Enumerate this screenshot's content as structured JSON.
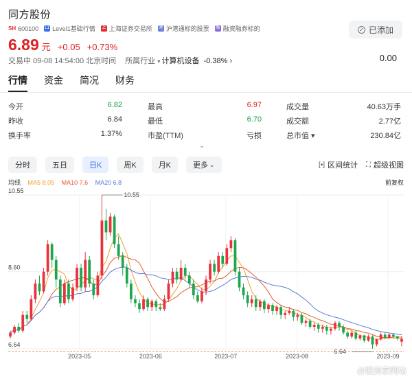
{
  "stock": {
    "name": "同方股份",
    "market": "SH",
    "code": "600100",
    "tags": [
      {
        "label": "Level1基础行情",
        "color": "#3b6fe8",
        "icon": "level1-icon",
        "glyph": "L1"
      },
      {
        "label": "上海证券交易所",
        "color": "#e03030",
        "icon": "exchange-icon",
        "glyph": "上"
      },
      {
        "label": "沪港通标的股票",
        "color": "#6a7bd8",
        "icon": "connect-icon",
        "glyph": "港"
      },
      {
        "label": "融资融券标的",
        "color": "#8a6ad8",
        "icon": "margin-icon",
        "glyph": "融"
      }
    ],
    "added_label": "已添加",
    "price": "6.89",
    "unit": "元",
    "change": "+0.05",
    "change_pct": "+0.73%",
    "status_time": "交易中 09-08 14:54:00 北京时间",
    "industry_label": "所属行业",
    "industry": "计算机设备",
    "industry_change": "-0.38%",
    "right_value": "0.00"
  },
  "tabs": [
    "行情",
    "资金",
    "简况",
    "财务"
  ],
  "stats": [
    {
      "label": "今开",
      "value": "6.82",
      "color": "green"
    },
    {
      "label": "最高",
      "value": "6.97",
      "color": "red"
    },
    {
      "label": "成交量",
      "value": "40.63万手",
      "color": "dark"
    },
    {
      "label": "昨收",
      "value": "6.84",
      "color": "dark"
    },
    {
      "label": "最低",
      "value": "6.70",
      "color": "green"
    },
    {
      "label": "成交额",
      "value": "2.77亿",
      "color": "dark"
    },
    {
      "label": "换手率",
      "value": "1.37%",
      "color": "dark"
    },
    {
      "label": "市盈(TTM)",
      "value": "亏损",
      "color": "dark"
    },
    {
      "label": "总市值 ▾",
      "value": "230.84亿",
      "color": "dark"
    }
  ],
  "periods": [
    "分时",
    "五日",
    "日K",
    "周K",
    "月K",
    "更多"
  ],
  "active_period": "日K",
  "tools": {
    "interval": "区间统计",
    "super": "超级视图"
  },
  "ma": {
    "title": "均线",
    "ma5": "MA5 8.05",
    "ma10": "MA10 7.6",
    "ma20": "MA20 6.8",
    "ma5_color": "#f0a030",
    "ma10_color": "#e85a2a",
    "ma20_color": "#5a7ad8"
  },
  "fq_label": "前复权",
  "chart_data": {
    "type": "candlestick",
    "title": "",
    "ylim": [
      6.64,
      10.55
    ],
    "y_ticks": [
      "10.55",
      "8.60",
      "6.64"
    ],
    "x_ticks": [
      "2023-05",
      "2023-06",
      "2023-07",
      "2023-08",
      "2023-09"
    ],
    "max_label": "10.55",
    "min_label": "6.64",
    "up_color": "#e8323c",
    "down_color": "#1ea64f",
    "candles": [
      {
        "o": 6.95,
        "c": 7.05,
        "h": 7.1,
        "l": 6.9
      },
      {
        "o": 7.05,
        "c": 7.2,
        "h": 7.25,
        "l": 7.0
      },
      {
        "o": 7.2,
        "c": 7.1,
        "h": 7.3,
        "l": 7.05
      },
      {
        "o": 7.1,
        "c": 7.5,
        "h": 7.6,
        "l": 7.05
      },
      {
        "o": 7.5,
        "c": 7.4,
        "h": 7.6,
        "l": 7.3
      },
      {
        "o": 7.4,
        "c": 7.9,
        "h": 8.0,
        "l": 7.35
      },
      {
        "o": 7.9,
        "c": 8.3,
        "h": 8.4,
        "l": 7.8
      },
      {
        "o": 8.3,
        "c": 8.1,
        "h": 8.5,
        "l": 8.0
      },
      {
        "o": 8.1,
        "c": 8.6,
        "h": 8.7,
        "l": 8.05
      },
      {
        "o": 8.6,
        "c": 9.3,
        "h": 9.4,
        "l": 8.5
      },
      {
        "o": 9.3,
        "c": 8.9,
        "h": 9.35,
        "l": 8.7
      },
      {
        "o": 8.9,
        "c": 8.4,
        "h": 9.0,
        "l": 8.2
      },
      {
        "o": 8.4,
        "c": 7.8,
        "h": 8.5,
        "l": 7.7
      },
      {
        "o": 7.8,
        "c": 8.3,
        "h": 8.4,
        "l": 7.75
      },
      {
        "o": 8.3,
        "c": 7.9,
        "h": 8.4,
        "l": 7.8
      },
      {
        "o": 7.9,
        "c": 8.2,
        "h": 8.3,
        "l": 7.85
      },
      {
        "o": 8.2,
        "c": 8.7,
        "h": 8.8,
        "l": 8.1
      },
      {
        "o": 8.7,
        "c": 8.2,
        "h": 8.8,
        "l": 8.1
      },
      {
        "o": 8.2,
        "c": 8.9,
        "h": 9.1,
        "l": 8.1
      },
      {
        "o": 8.9,
        "c": 8.3,
        "h": 9.0,
        "l": 8.2
      },
      {
        "o": 8.3,
        "c": 8.0,
        "h": 8.4,
        "l": 7.9
      },
      {
        "o": 8.0,
        "c": 8.5,
        "h": 8.6,
        "l": 7.95
      },
      {
        "o": 8.5,
        "c": 9.9,
        "h": 10.55,
        "l": 8.4
      },
      {
        "o": 9.9,
        "c": 9.6,
        "h": 10.2,
        "l": 9.4
      },
      {
        "o": 9.6,
        "c": 10.0,
        "h": 10.1,
        "l": 9.5
      },
      {
        "o": 10.0,
        "c": 9.3,
        "h": 10.05,
        "l": 9.2
      },
      {
        "o": 9.3,
        "c": 9.0,
        "h": 9.5,
        "l": 8.9
      },
      {
        "o": 9.0,
        "c": 8.7,
        "h": 9.1,
        "l": 8.5
      },
      {
        "o": 8.7,
        "c": 8.3,
        "h": 8.8,
        "l": 8.2
      },
      {
        "o": 8.3,
        "c": 7.9,
        "h": 8.4,
        "l": 7.8
      },
      {
        "o": 7.9,
        "c": 7.8,
        "h": 8.0,
        "l": 7.7
      },
      {
        "o": 7.8,
        "c": 7.65,
        "h": 7.9,
        "l": 7.55
      },
      {
        "o": 7.65,
        "c": 7.9,
        "h": 8.0,
        "l": 7.6
      },
      {
        "o": 7.9,
        "c": 7.7,
        "h": 7.95,
        "l": 7.6
      },
      {
        "o": 7.7,
        "c": 7.85,
        "h": 7.9,
        "l": 7.6
      },
      {
        "o": 7.85,
        "c": 7.7,
        "h": 7.9,
        "l": 7.6
      },
      {
        "o": 7.7,
        "c": 7.65,
        "h": 7.8,
        "l": 7.6
      },
      {
        "o": 7.65,
        "c": 7.9,
        "h": 8.0,
        "l": 7.6
      },
      {
        "o": 7.9,
        "c": 8.3,
        "h": 8.4,
        "l": 7.85
      },
      {
        "o": 8.3,
        "c": 8.6,
        "h": 8.7,
        "l": 8.2
      },
      {
        "o": 8.6,
        "c": 8.4,
        "h": 8.7,
        "l": 8.3
      },
      {
        "o": 8.4,
        "c": 8.7,
        "h": 8.9,
        "l": 8.35
      },
      {
        "o": 8.7,
        "c": 8.5,
        "h": 8.8,
        "l": 8.4
      },
      {
        "o": 8.5,
        "c": 8.3,
        "h": 8.6,
        "l": 8.2
      },
      {
        "o": 8.3,
        "c": 8.0,
        "h": 8.4,
        "l": 7.9
      },
      {
        "o": 8.0,
        "c": 7.85,
        "h": 8.1,
        "l": 7.8
      },
      {
        "o": 7.85,
        "c": 8.1,
        "h": 8.2,
        "l": 7.8
      },
      {
        "o": 8.1,
        "c": 8.4,
        "h": 8.5,
        "l": 8.0
      },
      {
        "o": 8.4,
        "c": 8.8,
        "h": 8.9,
        "l": 8.3
      },
      {
        "o": 8.8,
        "c": 8.6,
        "h": 8.9,
        "l": 8.5
      },
      {
        "o": 8.6,
        "c": 9.0,
        "h": 9.1,
        "l": 8.55
      },
      {
        "o": 9.0,
        "c": 8.8,
        "h": 9.1,
        "l": 8.7
      },
      {
        "o": 8.8,
        "c": 9.2,
        "h": 9.3,
        "l": 8.75
      },
      {
        "o": 9.2,
        "c": 9.4,
        "h": 9.5,
        "l": 9.1
      },
      {
        "o": 9.4,
        "c": 8.6,
        "h": 9.45,
        "l": 8.5
      },
      {
        "o": 8.6,
        "c": 8.2,
        "h": 8.7,
        "l": 8.1
      },
      {
        "o": 8.2,
        "c": 8.0,
        "h": 8.3,
        "l": 7.9
      },
      {
        "o": 8.0,
        "c": 7.8,
        "h": 8.1,
        "l": 7.7
      },
      {
        "o": 7.8,
        "c": 7.9,
        "h": 8.0,
        "l": 7.7
      },
      {
        "o": 7.9,
        "c": 7.7,
        "h": 8.0,
        "l": 7.6
      },
      {
        "o": 7.7,
        "c": 7.85,
        "h": 7.9,
        "l": 7.6
      },
      {
        "o": 7.85,
        "c": 7.65,
        "h": 7.9,
        "l": 7.55
      },
      {
        "o": 7.65,
        "c": 7.75,
        "h": 7.8,
        "l": 7.55
      },
      {
        "o": 7.75,
        "c": 7.6,
        "h": 7.8,
        "l": 7.5
      },
      {
        "o": 7.6,
        "c": 7.7,
        "h": 7.75,
        "l": 7.5
      },
      {
        "o": 7.7,
        "c": 7.5,
        "h": 7.75,
        "l": 7.4
      },
      {
        "o": 7.5,
        "c": 7.55,
        "h": 7.6,
        "l": 7.4
      },
      {
        "o": 7.55,
        "c": 7.6,
        "h": 7.7,
        "l": 7.5
      },
      {
        "o": 7.6,
        "c": 7.45,
        "h": 7.65,
        "l": 7.35
      },
      {
        "o": 7.45,
        "c": 7.5,
        "h": 7.55,
        "l": 7.35
      },
      {
        "o": 7.5,
        "c": 7.3,
        "h": 7.55,
        "l": 7.25
      },
      {
        "o": 7.3,
        "c": 7.35,
        "h": 7.4,
        "l": 7.2
      },
      {
        "o": 7.35,
        "c": 7.2,
        "h": 7.4,
        "l": 7.15
      },
      {
        "o": 7.2,
        "c": 7.25,
        "h": 7.3,
        "l": 7.1
      },
      {
        "o": 7.25,
        "c": 7.15,
        "h": 7.3,
        "l": 7.05
      },
      {
        "o": 7.15,
        "c": 7.2,
        "h": 7.25,
        "l": 7.05
      },
      {
        "o": 7.2,
        "c": 7.1,
        "h": 7.25,
        "l": 7.0
      },
      {
        "o": 7.1,
        "c": 7.15,
        "h": 7.2,
        "l": 7.0
      },
      {
        "o": 7.15,
        "c": 7.3,
        "h": 7.35,
        "l": 7.1
      },
      {
        "o": 7.3,
        "c": 7.2,
        "h": 7.35,
        "l": 7.1
      },
      {
        "o": 7.2,
        "c": 7.05,
        "h": 7.25,
        "l": 7.0
      },
      {
        "o": 7.05,
        "c": 6.95,
        "h": 7.1,
        "l": 6.9
      },
      {
        "o": 6.95,
        "c": 7.05,
        "h": 7.1,
        "l": 6.9
      },
      {
        "o": 7.05,
        "c": 6.9,
        "h": 7.1,
        "l": 6.85
      },
      {
        "o": 6.9,
        "c": 6.98,
        "h": 7.0,
        "l": 6.85
      },
      {
        "o": 6.98,
        "c": 6.85,
        "h": 7.0,
        "l": 6.8
      },
      {
        "o": 6.85,
        "c": 6.95,
        "h": 7.0,
        "l": 6.82
      },
      {
        "o": 6.95,
        "c": 6.75,
        "h": 6.98,
        "l": 6.64
      },
      {
        "o": 6.75,
        "c": 6.88,
        "h": 6.9,
        "l": 6.7
      },
      {
        "o": 6.88,
        "c": 7.0,
        "h": 7.05,
        "l": 6.85
      },
      {
        "o": 7.0,
        "c": 6.92,
        "h": 7.05,
        "l": 6.88
      },
      {
        "o": 6.92,
        "c": 7.0,
        "h": 7.02,
        "l": 6.9
      },
      {
        "o": 7.0,
        "c": 6.95,
        "h": 7.02,
        "l": 6.9
      },
      {
        "o": 6.95,
        "c": 6.9,
        "h": 6.97,
        "l": 6.85
      },
      {
        "o": 6.82,
        "c": 6.89,
        "h": 6.97,
        "l": 6.7
      }
    ]
  },
  "watermark": "@股资家网站"
}
